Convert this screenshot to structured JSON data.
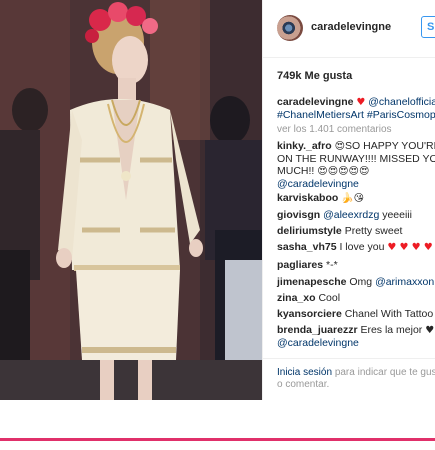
{
  "account": {
    "username": "caradelevingne",
    "follow_label": "S"
  },
  "likes_text": "749k Me gusta",
  "caption": {
    "username": "caradelevingne",
    "mention": "@chanelofficial",
    "hashtags": "#ChanelMetiersArt #ParisCosmopolit"
  },
  "view_comments": "ver los 1.401 comentarios",
  "comments": [
    {
      "user": "kinky._afro",
      "line1": "SO HAPPY YOU'RE B",
      "line2": "ON THE RUNWAY!!!! MISSED YOU S",
      "line3": "MUCH!!",
      "mention": "@caradelevingne"
    },
    {
      "user": "karviskaboo",
      "text": ""
    },
    {
      "user": "giovisgn",
      "mention": "@aleexrdzg",
      "text": "yeeeiii"
    },
    {
      "user": "deliriumstyle",
      "text": "Pretty sweet"
    },
    {
      "user": "sasha_vh75",
      "text": "I love you"
    },
    {
      "user": "pagliares",
      "text": "*-*"
    },
    {
      "user": "jimenapesche",
      "text": "Omg",
      "mention": "@arimaxxon"
    },
    {
      "user": "zina_xo",
      "text": "Cool"
    },
    {
      "user": "kyansorciere",
      "text": "Chanel With Tattoo"
    },
    {
      "user": "brenda_juarezzr",
      "text": "Eres la mejor",
      "mention": "@caradelevingne"
    }
  ],
  "login": {
    "link": "Inicia sesión",
    "rest1": "para indicar que te gust",
    "rest2": "o comentar."
  },
  "colors": {
    "accent_blue": "#3897f0",
    "link": "#003569",
    "heart": "#ed1c24",
    "bottom_line": "#e0306a"
  }
}
